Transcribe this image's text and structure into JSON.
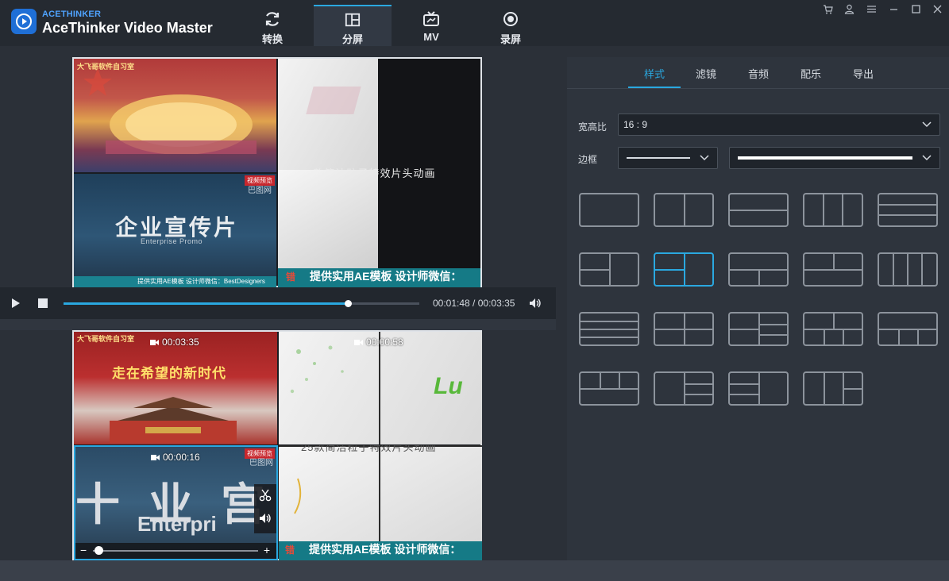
{
  "app": {
    "brand_small": "ACETHINKER",
    "brand": "AceThinker Video Master"
  },
  "nav": {
    "tabs": [
      {
        "label": "转换",
        "icon": "refresh-icon"
      },
      {
        "label": "分屏",
        "icon": "split-screen-icon",
        "active": true
      },
      {
        "label": "MV",
        "icon": "tv-icon"
      },
      {
        "label": "录屏",
        "icon": "record-icon"
      }
    ]
  },
  "preview": {
    "cells": {
      "top_left_watermark": "大飞哥软件自习室",
      "right_title": "25款简洁粒子特效片头动画",
      "right_banner": "提供实用AE模板  设计师微信：",
      "bottom_left_title": "企业宣传片",
      "bottom_left_sub": "Enterprise Promo",
      "bottom_left_badge": "视频预览",
      "bottom_left_logo": "巴图网",
      "bottom_left_banner": "提供实用AE模板  设计师微信：BestDesigners",
      "right_banner_prefix": "错"
    }
  },
  "player": {
    "current_time": "00:01:48",
    "separator": " / ",
    "total_time": "00:03:35",
    "progress": 0.8
  },
  "editor": {
    "cells": [
      {
        "duration": "00:03:35",
        "text": "走在希望的新时代",
        "watermark": "大飞哥软件自习室"
      },
      {
        "duration": "00:00:58",
        "text": "Lu"
      },
      {
        "duration": "00:00:16",
        "text": "Enterpri",
        "badge": "视频预览",
        "logo": "巴图网"
      },
      {
        "text": "25款简洁粒子特效片头动画",
        "banner": "提供实用AE模板  设计师微信："
      }
    ],
    "volume_minus": "−",
    "volume_plus": "+"
  },
  "right": {
    "tabs": [
      "样式",
      "滤镜",
      "音频",
      "配乐",
      "导出"
    ],
    "active_tab": "样式",
    "aspect_label": "宽高比",
    "aspect_value": "16 : 9",
    "border_label": "边框"
  },
  "colors": {
    "accent": "#2aa8e0",
    "panel": "#2e343d",
    "background": "#2b3038"
  }
}
